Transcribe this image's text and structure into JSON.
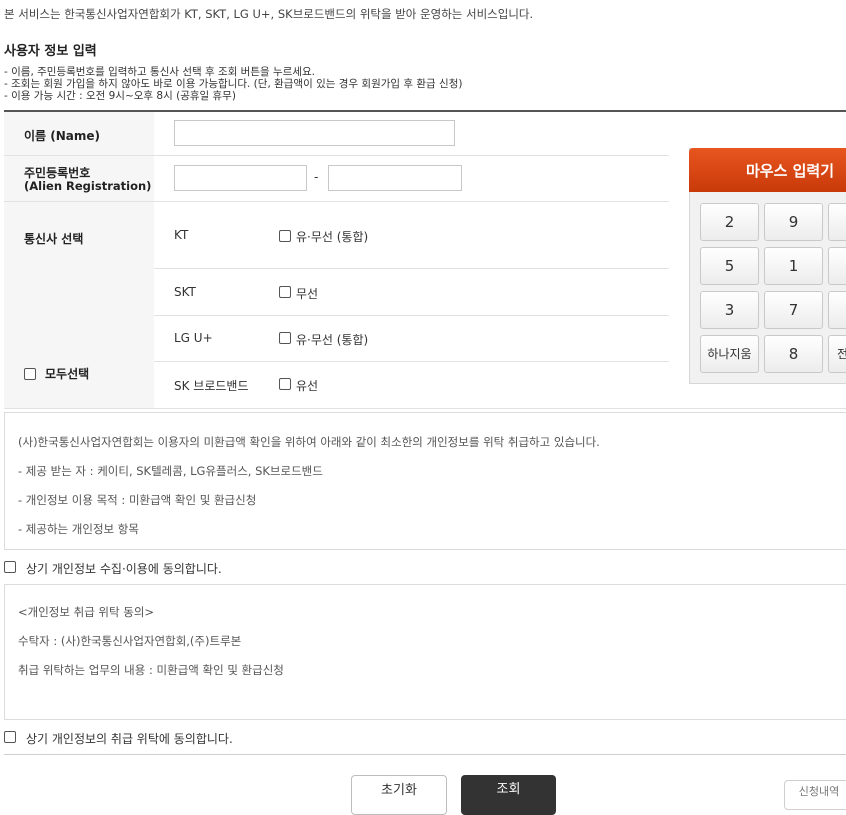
{
  "notice": "본 서비스는 한국통신사업자연합회가 KT, SKT, LG U+, SK브로드밴드의 위탁을 받아 운영하는 서비스입니다.",
  "section_title": "사용자 정보 입력",
  "guide": [
    "- 이름, 주민등록번호를 입력하고 통신사 선택 후 조회 버튼을 누르세요.",
    "- 조회는 회원 가입을 하지 않아도 바로 이용 가능합니다. (단, 환급액이 있는 경우 회원가입 후 환급 신청)",
    "- 이용 가능 시간 : 오전 9시~오후 8시 (공휴일 휴무)"
  ],
  "form": {
    "name_label": "이름 (Name)",
    "name_value": "",
    "id_label": "주민등록번호",
    "id_sub_label": "(Alien Registration)",
    "id_front_value": "",
    "id_separator": "-",
    "id_back_value": "",
    "carrier_label": "통신사 선택",
    "select_all_label": "모두선택",
    "carriers": [
      {
        "name": "KT",
        "option": "유·무선 (통합)",
        "checked": false
      },
      {
        "name": "SKT",
        "option": "무선",
        "checked": false
      },
      {
        "name": "LG U+",
        "option": "유·무선 (통합)",
        "checked": false
      },
      {
        "name": "SK 브로드밴드",
        "option": "유선",
        "checked": false
      }
    ]
  },
  "keypad": {
    "title": "마우스 입력기",
    "keys": [
      [
        "2",
        "9",
        ""
      ],
      [
        "5",
        "1",
        ""
      ],
      [
        "3",
        "7",
        ""
      ],
      [
        "하나지움",
        "8",
        "전"
      ]
    ]
  },
  "privacy": {
    "lines": [
      "(사)한국통신사업자연합회는 이용자의 미환급액 확인을 위하여 아래와 같이 최소한의 개인정보를 위탁 취급하고 있습니다.",
      "- 제공 받는 자 : 케이티, SK텔레콤, LG유플러스, SK브로드밴드",
      "- 개인정보 이용 목적 : 미환급액 확인 및 환급신청",
      "- 제공하는 개인정보 항목"
    ],
    "agree_label": "상기 개인정보 수집·이용에 동의합니다."
  },
  "consignment": {
    "lines": [
      "<개인정보 취급 위탁 동의>",
      "수탁자 : (사)한국통신사업자연합회,(주)트루본",
      "취급 위탁하는 업무의 내용 : 미환급액 확인 및 환급신청"
    ],
    "agree_label": "상기 개인정보의 취급 위탁에 동의합니다."
  },
  "buttons": {
    "reset": "초기화",
    "search": "조회",
    "extra": "신청내역"
  }
}
